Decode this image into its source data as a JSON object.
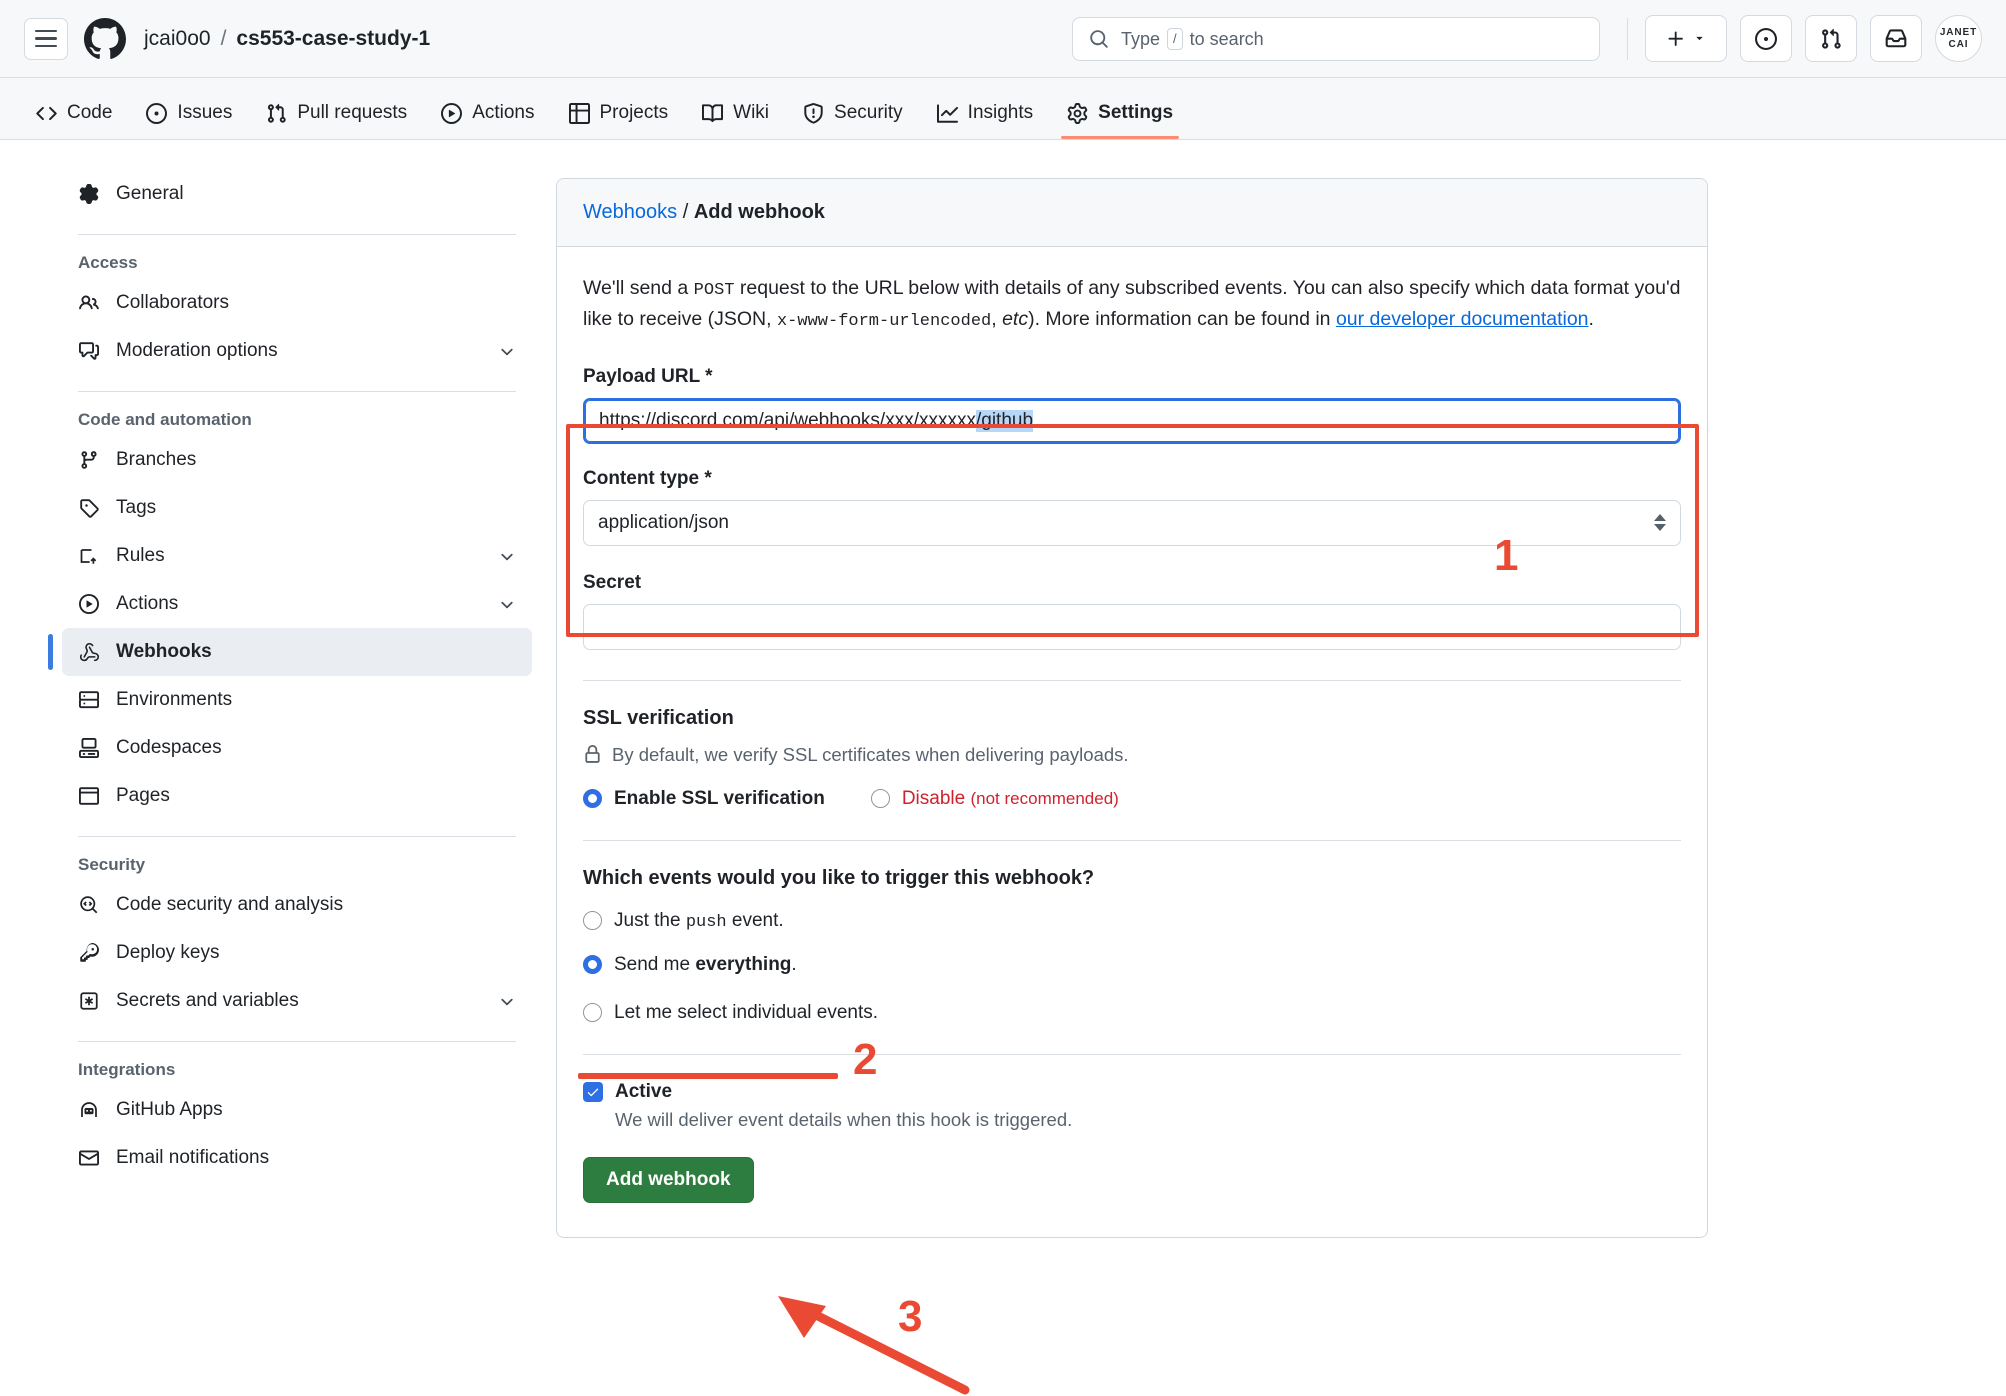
{
  "header": {
    "menu_icon": "hamburger-icon",
    "logo_icon": "github-logo-icon",
    "owner": "jcai0o0",
    "separator": "/",
    "repo": "cs553-case-study-1",
    "search_placeholder": "Type",
    "search_key": "/",
    "search_placeholder_suffix": "to search",
    "actions": [
      {
        "name": "create-new-button",
        "icon": "plus-icon"
      },
      {
        "name": "issues-button",
        "icon": "issue-opened-icon"
      },
      {
        "name": "pull-requests-button",
        "icon": "git-pull-request-icon"
      },
      {
        "name": "inbox-button",
        "icon": "inbox-icon"
      }
    ],
    "avatar_line1": "JANET",
    "avatar_line2": "CAI"
  },
  "nav_tabs": [
    {
      "label": "Code",
      "icon": "code-icon",
      "active": false
    },
    {
      "label": "Issues",
      "icon": "issue-opened-icon",
      "active": false
    },
    {
      "label": "Pull requests",
      "icon": "git-pull-request-icon",
      "active": false
    },
    {
      "label": "Actions",
      "icon": "play-icon",
      "active": false
    },
    {
      "label": "Projects",
      "icon": "table-icon",
      "active": false
    },
    {
      "label": "Wiki",
      "icon": "book-icon",
      "active": false
    },
    {
      "label": "Security",
      "icon": "shield-icon",
      "active": false
    },
    {
      "label": "Insights",
      "icon": "graph-icon",
      "active": false
    },
    {
      "label": "Settings",
      "icon": "gear-icon",
      "active": true
    }
  ],
  "sidebar": {
    "general": {
      "label": "General",
      "icon": "gear-icon"
    },
    "groups": [
      {
        "title": "Access",
        "items": [
          {
            "label": "Collaborators",
            "icon": "people-icon",
            "chevron": false,
            "active": false
          },
          {
            "label": "Moderation options",
            "icon": "comment-discussion-icon",
            "chevron": true,
            "active": false
          }
        ]
      },
      {
        "title": "Code and automation",
        "items": [
          {
            "label": "Branches",
            "icon": "git-branch-icon",
            "chevron": false,
            "active": false
          },
          {
            "label": "Tags",
            "icon": "tag-icon",
            "chevron": false,
            "active": false
          },
          {
            "label": "Rules",
            "icon": "rules-icon",
            "chevron": true,
            "active": false
          },
          {
            "label": "Actions",
            "icon": "play-icon",
            "chevron": true,
            "active": false
          },
          {
            "label": "Webhooks",
            "icon": "webhook-icon",
            "chevron": false,
            "active": true
          },
          {
            "label": "Environments",
            "icon": "server-icon",
            "chevron": false,
            "active": false
          },
          {
            "label": "Codespaces",
            "icon": "codespaces-icon",
            "chevron": false,
            "active": false
          },
          {
            "label": "Pages",
            "icon": "browser-icon",
            "chevron": false,
            "active": false
          }
        ]
      },
      {
        "title": "Security",
        "items": [
          {
            "label": "Code security and analysis",
            "icon": "code-scan-icon",
            "chevron": false,
            "active": false
          },
          {
            "label": "Deploy keys",
            "icon": "key-icon",
            "chevron": false,
            "active": false
          },
          {
            "label": "Secrets and variables",
            "icon": "asterisk-box-icon",
            "chevron": true,
            "active": false
          }
        ]
      },
      {
        "title": "Integrations",
        "items": [
          {
            "label": "GitHub Apps",
            "icon": "apps-icon",
            "chevron": false,
            "active": false
          },
          {
            "label": "Email notifications",
            "icon": "mail-icon",
            "chevron": false,
            "active": false
          }
        ]
      }
    ]
  },
  "panel": {
    "breadcrumb_link": "Webhooks",
    "breadcrumb_sep": "/",
    "breadcrumb_current": "Add webhook",
    "description": {
      "part1": "We'll send a ",
      "code1": "POST",
      "part2": " request to the URL below with details of any subscribed events. You can also specify which data format you'd like to receive (JSON, ",
      "code2": "x-www-form-urlencoded",
      "part3": ", ",
      "italic": "etc",
      "part4": "). More information can be found in ",
      "link": "our developer documentation",
      "part5": "."
    },
    "payload_url": {
      "label": "Payload URL *",
      "value_plain": "https://discord.com/api/webhooks/xxx/xxxxxx",
      "value_selected": "/github",
      "full_value": "https://discord.com/api/webhooks/xxx/xxxxxx/github"
    },
    "content_type": {
      "label": "Content type *",
      "value": "application/json"
    },
    "secret": {
      "label": "Secret",
      "value": ""
    },
    "ssl": {
      "title": "SSL verification",
      "note": "By default, we verify SSL certificates when delivering payloads.",
      "note_icon": "lock-icon",
      "options": [
        {
          "label": "Enable SSL verification",
          "selected": true,
          "danger": false
        },
        {
          "label": "Disable",
          "suffix": "(not recommended)",
          "selected": false,
          "danger": true
        }
      ]
    },
    "events": {
      "question": "Which events would you like to trigger this webhook?",
      "options": [
        {
          "prefix": "Just the ",
          "code": "push",
          "suffix": " event.",
          "selected": false
        },
        {
          "prefix": "Send me ",
          "bold": "everything",
          "suffix": ".",
          "selected": true
        },
        {
          "prefix": "Let me select individual events.",
          "selected": false
        }
      ]
    },
    "active": {
      "label": "Active",
      "checked": true,
      "note": "We will deliver event details when this hook is triggered.",
      "check_icon": "check-icon"
    },
    "submit_button": "Add webhook"
  },
  "annotations": {
    "color": "#ea4a33",
    "markers": [
      {
        "number": "1",
        "type": "box-with-number",
        "target": "payload-url-and-content-type"
      },
      {
        "number": "2",
        "type": "underline-with-number",
        "target": "send-me-everything-option"
      },
      {
        "number": "3",
        "type": "arrow-with-number",
        "target": "add-webhook-button"
      }
    ]
  }
}
